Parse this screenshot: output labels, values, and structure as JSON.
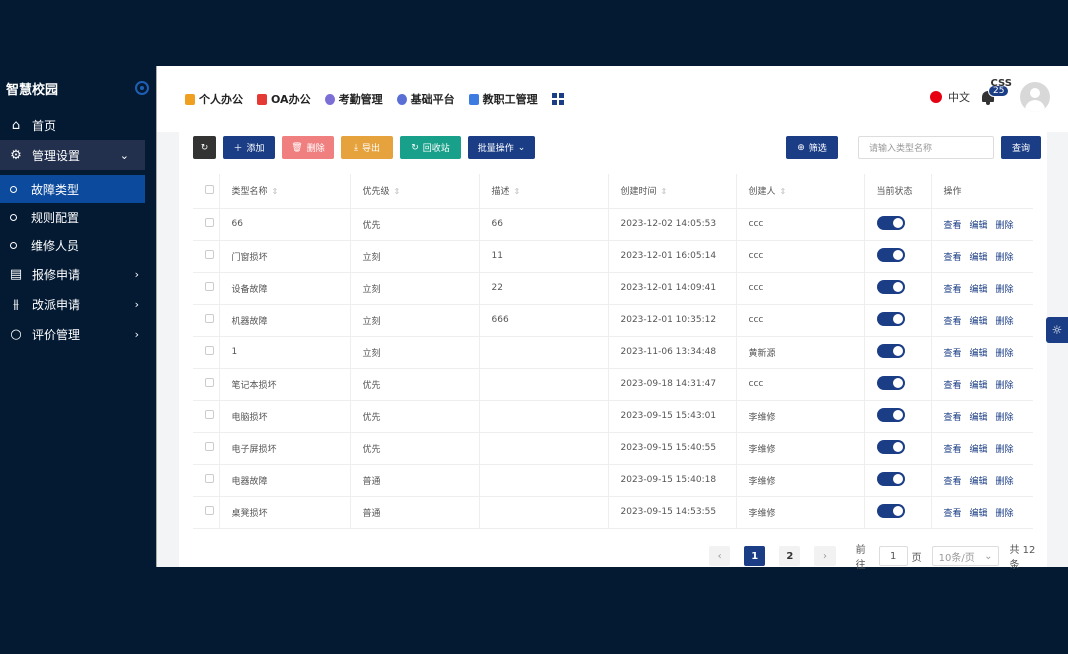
{
  "sidebar": {
    "title": "智慧校园",
    "items": [
      {
        "label": "首页"
      },
      {
        "label": "管理设置"
      },
      {
        "label": "故障类型"
      },
      {
        "label": "规则配置"
      },
      {
        "label": "维修人员"
      },
      {
        "label": "报修申请"
      },
      {
        "label": "改派申请"
      },
      {
        "label": "评价管理"
      }
    ]
  },
  "topnav": {
    "items": [
      {
        "label": "个人办公",
        "color": "#f0a020"
      },
      {
        "label": "OA办公",
        "color": "#e53935"
      },
      {
        "label": "考勤管理",
        "color": "#7b6fd6"
      },
      {
        "label": "基础平台",
        "color": "#5a6fd6"
      },
      {
        "label": "教职工管理",
        "color": "#3d7be0"
      }
    ],
    "lang": "中文",
    "badge": "25",
    "user": "css"
  },
  "toolbar": {
    "add": "添加",
    "delete": "删除",
    "export": "导出",
    "recycle": "回收站",
    "batch": "批量操作",
    "filter": "筛选",
    "search_placeholder": "请输入类型名称",
    "query": "查询"
  },
  "table": {
    "headers": [
      "类型名称",
      "优先级",
      "描述",
      "创建时间",
      "创建人",
      "当前状态",
      "操作"
    ],
    "rows": [
      [
        "66",
        "优先",
        "66",
        "2023-12-02 14:05:53",
        "ccc"
      ],
      [
        "门窗损坏",
        "立刻",
        "11",
        "2023-12-01 16:05:14",
        "ccc"
      ],
      [
        "设备故障",
        "立刻",
        "22",
        "2023-12-01 14:09:41",
        "ccc"
      ],
      [
        "机器故障",
        "立刻",
        "666",
        "2023-12-01 10:35:12",
        "ccc"
      ],
      [
        "1",
        "立刻",
        "",
        "2023-11-06 13:34:48",
        "黄新源"
      ],
      [
        "笔记本损坏",
        "优先",
        "",
        "2023-09-18 14:31:47",
        "ccc"
      ],
      [
        "电脑损坏",
        "优先",
        "",
        "2023-09-15 15:43:01",
        "李维修"
      ],
      [
        "电子屏损坏",
        "优先",
        "",
        "2023-09-15 15:40:55",
        "李维修"
      ],
      [
        "电器故障",
        "普通",
        "",
        "2023-09-15 15:40:18",
        "李维修"
      ],
      [
        "桌凳损坏",
        "普通",
        "",
        "2023-09-15 14:53:55",
        "李维修"
      ]
    ],
    "ops": [
      "查看",
      "编辑",
      "删除"
    ]
  },
  "pager": {
    "pages": [
      "1",
      "2"
    ],
    "goto": "前往",
    "page_value": "1",
    "page_unit": "页",
    "size": "10条/页",
    "total": "共 12 条"
  }
}
